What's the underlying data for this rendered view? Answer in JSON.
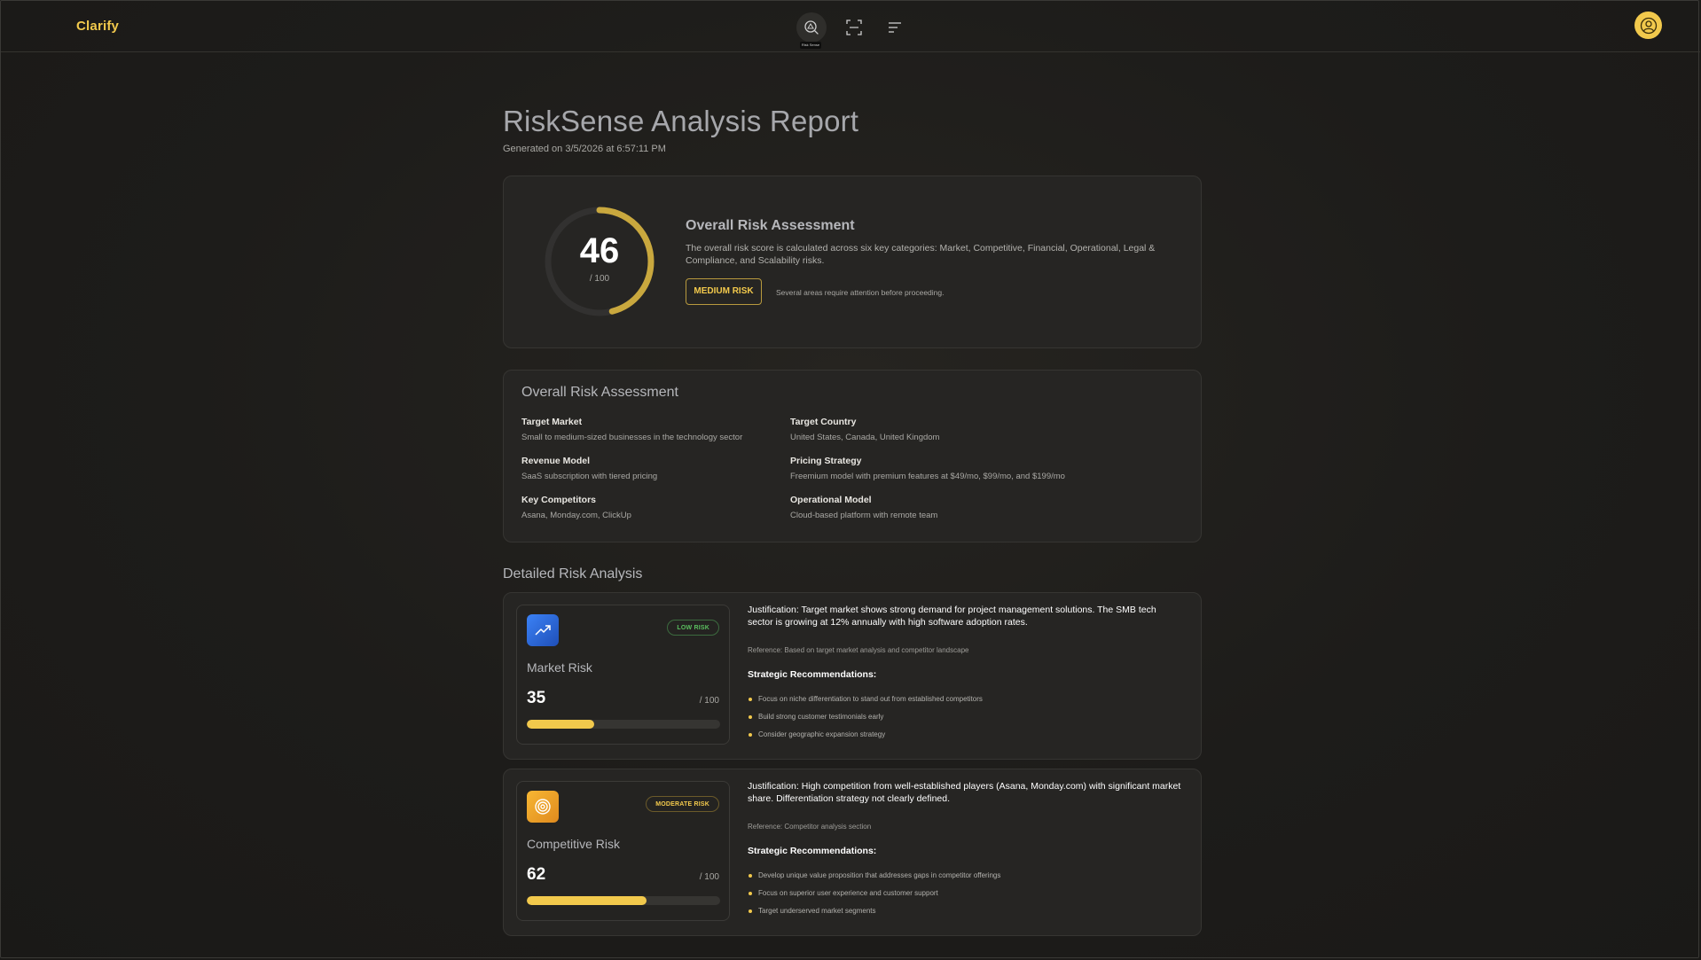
{
  "app": {
    "name": "Clarify"
  },
  "nav": {
    "tooltip": "Risk Sense",
    "items": [
      {
        "icon": "risk-search-icon",
        "active": true
      },
      {
        "icon": "scan-frame-icon",
        "active": false
      },
      {
        "icon": "menu-lines-icon",
        "active": false
      }
    ],
    "avatar_icon": "user-circle-icon"
  },
  "report": {
    "title": "RiskSense Analysis Report",
    "generated": "Generated on 3/5/2026 at 6:57:11 PM"
  },
  "overall": {
    "score": "46",
    "score_value": 46,
    "denominator": "/ 100",
    "title": "Overall Risk Assessment",
    "description": "The overall risk score is calculated across six key categories: Market, Competitive, Financial, Operational, Legal & Compliance, and Scalability risks.",
    "level": "MEDIUM RISK",
    "note": "Several areas require attention before proceeding."
  },
  "summary": {
    "title": "Overall Risk Assessment",
    "fields": [
      {
        "label": "Target Market",
        "value": "Small to medium-sized businesses in the technology sector"
      },
      {
        "label": "Target Country",
        "value": "United States, Canada, United Kingdom"
      },
      {
        "label": "Revenue Model",
        "value": "SaaS subscription with tiered pricing"
      },
      {
        "label": "Pricing Strategy",
        "value": "Freemium model with premium features at $49/mo, $99/mo, and $199/mo"
      },
      {
        "label": "Key Competitors",
        "value": "Asana, Monday.com, ClickUp"
      },
      {
        "label": "Operational Model",
        "value": "Cloud-based platform with remote team"
      }
    ]
  },
  "detailed": {
    "title": "Detailed Risk Analysis",
    "risks": [
      {
        "name": "Market Risk",
        "icon": "trending-up-icon",
        "badge": "LOW RISK",
        "score": "35",
        "score_value": 35,
        "denominator": "/ 100",
        "justification": "Justification: Target market shows strong demand for project management solutions. The SMB tech sector is growing at 12% annually with high software adoption rates.",
        "reference": "Reference: Based on target market analysis and competitor landscape",
        "rec_title": "Strategic Recommendations:",
        "recommendations": [
          "Focus on niche differentiation to stand out from established competitors",
          "Build strong customer testimonials early",
          "Consider geographic expansion strategy"
        ]
      },
      {
        "name": "Competitive Risk",
        "icon": "target-icon",
        "badge": "MODERATE RISK",
        "score": "62",
        "score_value": 62,
        "denominator": "/ 100",
        "justification": "Justification: High competition from well-established players (Asana, Monday.com) with significant market share. Differentiation strategy not clearly defined.",
        "reference": "Reference: Competitor analysis section",
        "rec_title": "Strategic Recommendations:",
        "recommendations": [
          "Develop unique value proposition that addresses gaps in competitor offerings",
          "Focus on superior user experience and customer support",
          "Target underserved market segments"
        ]
      }
    ]
  },
  "colors": {
    "accent": "#f2c94c",
    "low_risk": "#4caf50",
    "moderate_risk": "#f2c94c",
    "market_icon_bg": "#2f6fe0",
    "competitive_icon_bg": "#f0a830"
  }
}
